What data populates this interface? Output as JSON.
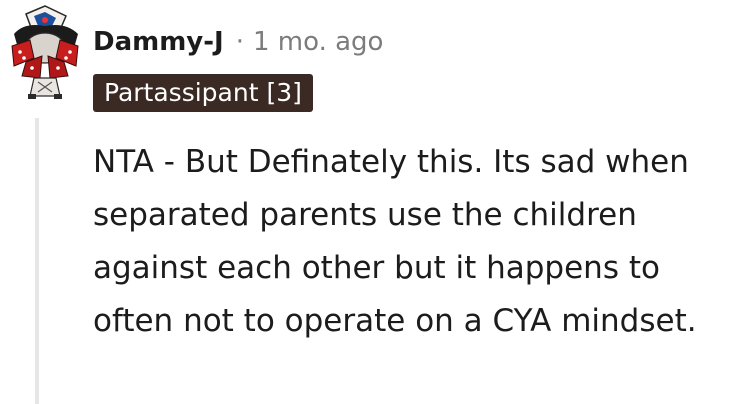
{
  "comment": {
    "author": "Dammy-J",
    "separator": "·",
    "timestamp": "1 mo. ago",
    "flair": "Partassipant [3]",
    "body": "NTA - But Definately this. Its sad when separated parents use the children against each other but it happens to often not to operate on a CYA mindset."
  },
  "colors": {
    "flair_bg": "#3a2a23",
    "text": "#1c1c1c",
    "meta": "#7c7c7c",
    "thread_line": "#e6e6e6"
  },
  "icons": {
    "avatar": "snoo-avatar-icon"
  }
}
